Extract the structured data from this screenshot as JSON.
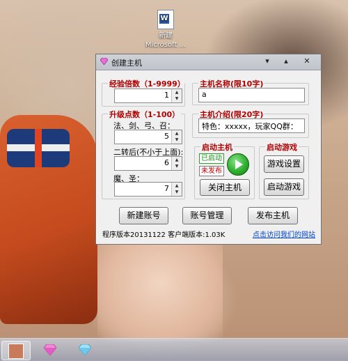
{
  "desktop_icon": {
    "line1": "新建",
    "line2": "Microsoft ..."
  },
  "window": {
    "title": "创建主机",
    "controls": {
      "minimize": "▾",
      "restore": "▴",
      "close": "✕"
    }
  },
  "exp_group": {
    "label": "经验倍数（1-9999）",
    "value": "1"
  },
  "upgrade_group": {
    "label": "升级点数（1-100）",
    "class_label": "法、剑、弓、召：",
    "class_value": "5",
    "rebirth_label": "二转后(不小于上面):",
    "rebirth_value": "6",
    "magic_label": "魔、圣：",
    "magic_value": "7"
  },
  "host_name": {
    "label": "主机名称(限10字)",
    "value": "a"
  },
  "host_intro": {
    "label": "主机介绍(限20字)",
    "value": "特色：xxxxx，玩家QQ群："
  },
  "start_host": {
    "label": "启动主机",
    "status_started": "已启动",
    "status_unpublished": "未发布",
    "close_button": "关闭主机"
  },
  "start_game": {
    "label": "启动游戏",
    "settings_button": "游戏设置",
    "launch_button": "启动游戏"
  },
  "bottom_buttons": {
    "new_account": "新建账号",
    "account_manage": "账号管理",
    "publish_host": "发布主机"
  },
  "footer": {
    "version": "程序版本20131122 客户端版本:1.03K",
    "website_link": "点击访问我们的网站"
  },
  "colors": {
    "accent_red": "#b00000",
    "link_blue": "#0044cc",
    "status_green": "#1a8c1a"
  }
}
